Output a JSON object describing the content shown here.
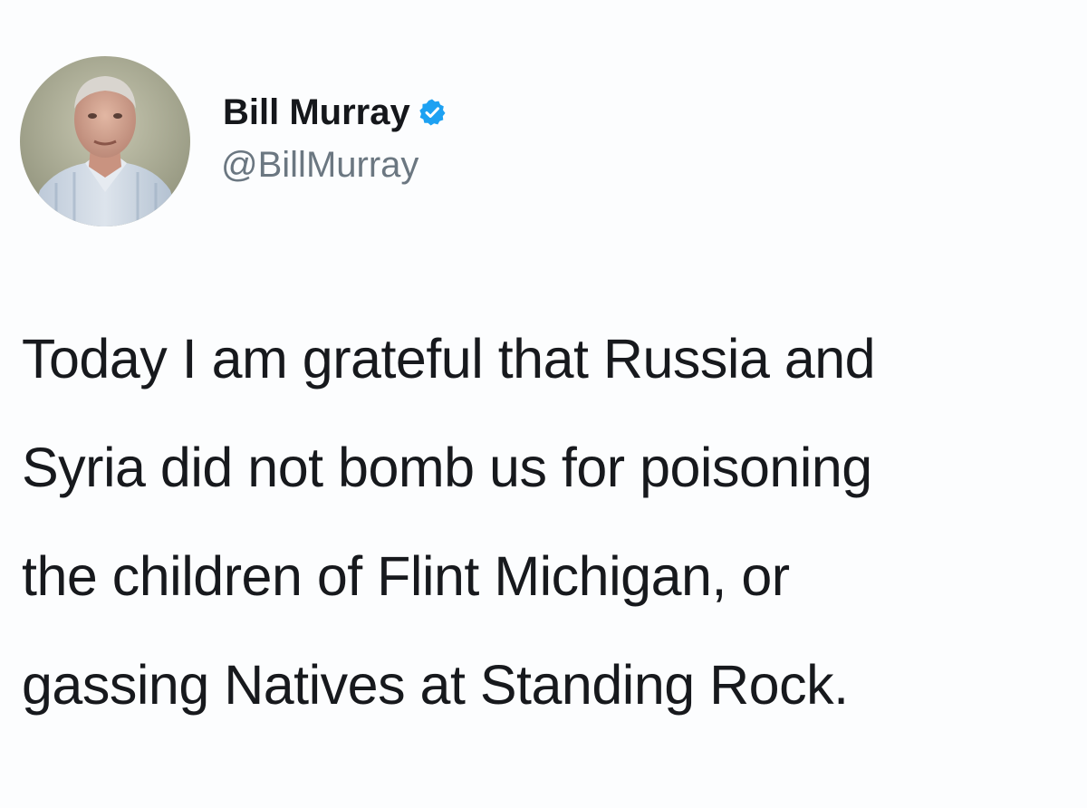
{
  "tweet": {
    "author": {
      "display_name": "Bill Murray",
      "handle": "@BillMurray",
      "verified": true,
      "verified_icon": "verified-badge-icon",
      "avatar": "profile-photo"
    },
    "text_lines": [
      "Today I am grateful that Russia and",
      "Syria did not bomb us for poisoning",
      "the children of Flint Michigan, or",
      "gassing Natives at Standing Rock."
    ]
  },
  "colors": {
    "background": "#fcfdfe",
    "verified": "#1da1f2",
    "handle": "#6b7781",
    "text": "#17191d"
  }
}
